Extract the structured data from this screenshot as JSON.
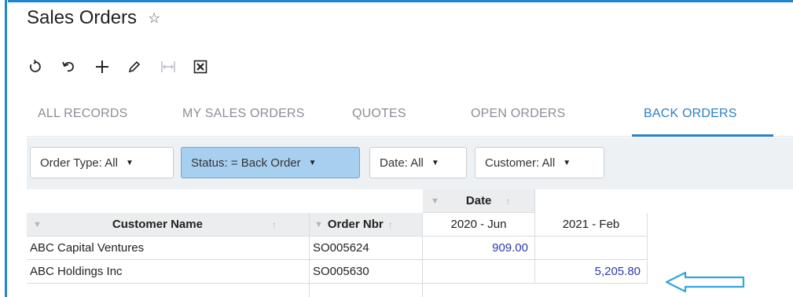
{
  "page": {
    "title": "Sales Orders",
    "star_icon": "☆"
  },
  "toolbar": {
    "buttons": [
      {
        "name": "refresh-icon"
      },
      {
        "name": "undo-icon"
      },
      {
        "name": "add-icon"
      },
      {
        "name": "edit-icon"
      },
      {
        "name": "fit-columns-icon",
        "disabled": true
      },
      {
        "name": "export-excel-icon"
      }
    ]
  },
  "tabs": {
    "all_records": "ALL RECORDS",
    "my_sales_orders": "MY SALES ORDERS",
    "quotes": "QUOTES",
    "open_orders": "OPEN ORDERS",
    "back_orders": "BACK ORDERS",
    "active": "BACK ORDERS"
  },
  "filters": {
    "order_type": "Order Type: All",
    "status": "Status: = Back Order",
    "date": "Date: All",
    "customer": "Customer: All"
  },
  "grid": {
    "pivot_header": "Date",
    "columns": {
      "customer_name": "Customer Name",
      "order_nbr": "Order Nbr",
      "period_1": "2020 - Jun",
      "period_2": "2021 - Feb"
    },
    "rows": [
      {
        "customer_name": "ABC Capital Ventures",
        "order_nbr": "SO005624",
        "period_1": "909.00",
        "period_2": ""
      },
      {
        "customer_name": "ABC Holdings Inc",
        "order_nbr": "SO005630",
        "period_1": "",
        "period_2": "5,205.80"
      }
    ]
  },
  "colors": {
    "accent": "#2b7fc7",
    "active_filter": "#a7cff0",
    "annotation_arrow": "#2fa6e0",
    "value_text": "#2e3aa8"
  }
}
